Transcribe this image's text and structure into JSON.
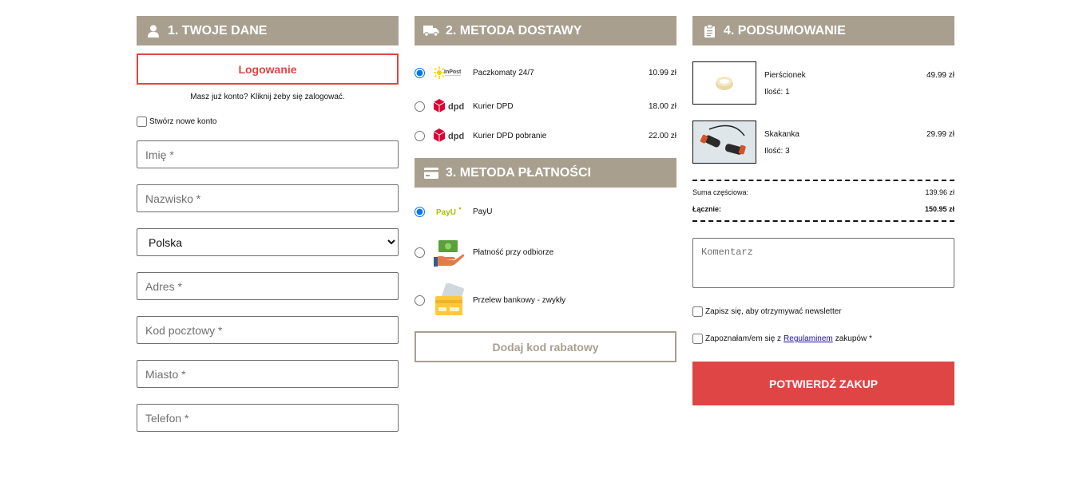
{
  "sections": {
    "personal": {
      "title": "1. TWOJE DANE",
      "icon": "user-icon"
    },
    "delivery": {
      "title": "2. METODA DOSTAWY",
      "icon": "truck-icon"
    },
    "payment": {
      "title": "3. METODA PŁATNOŚCI",
      "icon": "credit-card-icon"
    },
    "summary": {
      "title": "4. PODSUMOWANIE",
      "icon": "clipboard-icon"
    }
  },
  "personal": {
    "login_label": "Logowanie",
    "login_note": "Masz już konto? Kliknij żeby się zalogować.",
    "create_account_label": "Stwórz nowe konto",
    "fields": {
      "first_name": "Imię *",
      "last_name": "Nazwisko *",
      "country": "Polska",
      "address": "Adres *",
      "postal_code": "Kod pocztowy *",
      "city": "Miasto *",
      "phone": "Telefon *"
    }
  },
  "delivery": {
    "options": [
      {
        "logo": "InPost",
        "label": "Paczkomaty 24/7",
        "price": "10.99 zł",
        "selected": true
      },
      {
        "logo": "dpd",
        "label": "Kurier DPD",
        "price": "18.00 zł",
        "selected": false
      },
      {
        "logo": "dpd",
        "label": "Kurier DPD pobranie",
        "price": "22.00 zł",
        "selected": false
      }
    ]
  },
  "payment": {
    "options": [
      {
        "logo": "PayU",
        "label": "PayU",
        "selected": true
      },
      {
        "logo": "cash-hand-icon",
        "label": "Płatność przy odbiorze",
        "selected": false
      },
      {
        "logo": "bank-cards-icon",
        "label": "Przelew bankowy - zwykły",
        "selected": false
      }
    ],
    "discount_label": "Dodaj kod rabatowy"
  },
  "summary": {
    "items": [
      {
        "name": "Pierścionek",
        "qty": "Ilość: 1",
        "price": "49.99 zł"
      },
      {
        "name": "Skakanka",
        "qty": "Ilość: 3",
        "price": "29.99 zł"
      }
    ],
    "subtotal_label": "Suma częściowa:",
    "subtotal_value": "139.96 zł",
    "total_label": "Łącznie:",
    "total_value": "150.95 zł",
    "comment_placeholder": "Komentarz",
    "newsletter_label": "Zapisz się, aby otrzymywać newsletter",
    "terms_before": "Zapoznałam/em się z",
    "terms_link": "Regulaminem",
    "terms_after": "zakupów *",
    "confirm_label": "POTWIERDŹ ZAKUP"
  },
  "colors": {
    "header_bg": "#a89f8f",
    "accent_red": "#e04545",
    "dpd_red": "#dc0032",
    "inpost_yellow": "#ffcb04",
    "payu_green": "#a6c307"
  }
}
